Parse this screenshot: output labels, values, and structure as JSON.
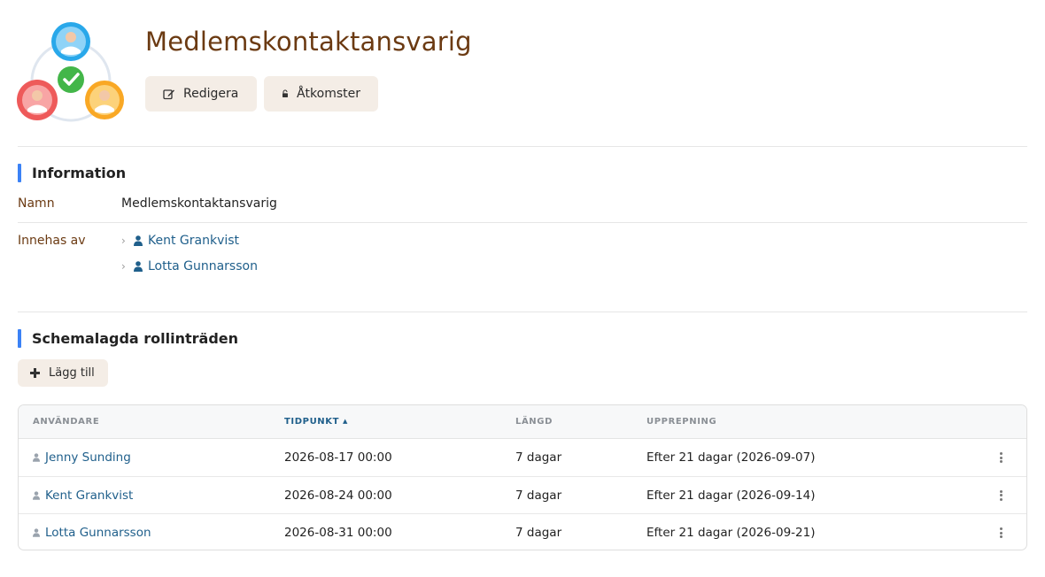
{
  "page": {
    "title": "Medlemskontaktansvarig",
    "icon": "role-group-icon"
  },
  "actions": {
    "edit_label": "Redigera",
    "access_label": "Åtkomster"
  },
  "information": {
    "heading": "Information",
    "name_label": "Namn",
    "name_value": "Medlemskontaktansvarig",
    "held_by_label": "Innehas av",
    "holders": [
      {
        "name": "Kent Grankvist"
      },
      {
        "name": "Lotta Gunnarsson"
      }
    ]
  },
  "scheduled": {
    "heading": "Schemalagda rollinträden",
    "add_label": "Lägg till",
    "columns": {
      "user": "ANVÄNDARE",
      "time": "TIDPUNKT",
      "length": "LÄNGD",
      "repeat": "UPPREPNING"
    },
    "sort_indicator": "▲",
    "rows": [
      {
        "user": "Jenny Sunding",
        "time": "2026-08-17 00:00",
        "length": "7 dagar",
        "repeat": "Efter 21 dagar (2026-09-07)"
      },
      {
        "user": "Kent Grankvist",
        "time": "2026-08-24 00:00",
        "length": "7 dagar",
        "repeat": "Efter 21 dagar (2026-09-14)"
      },
      {
        "user": "Lotta Gunnarsson",
        "time": "2026-08-31 00:00",
        "length": "7 dagar",
        "repeat": "Efter 21 dagar (2026-09-21)"
      }
    ]
  },
  "colors": {
    "accent_bar": "#3b82f6",
    "title_brown": "#6b3a12",
    "link_blue": "#1f5f8b",
    "button_bg": "#f4ede6"
  }
}
